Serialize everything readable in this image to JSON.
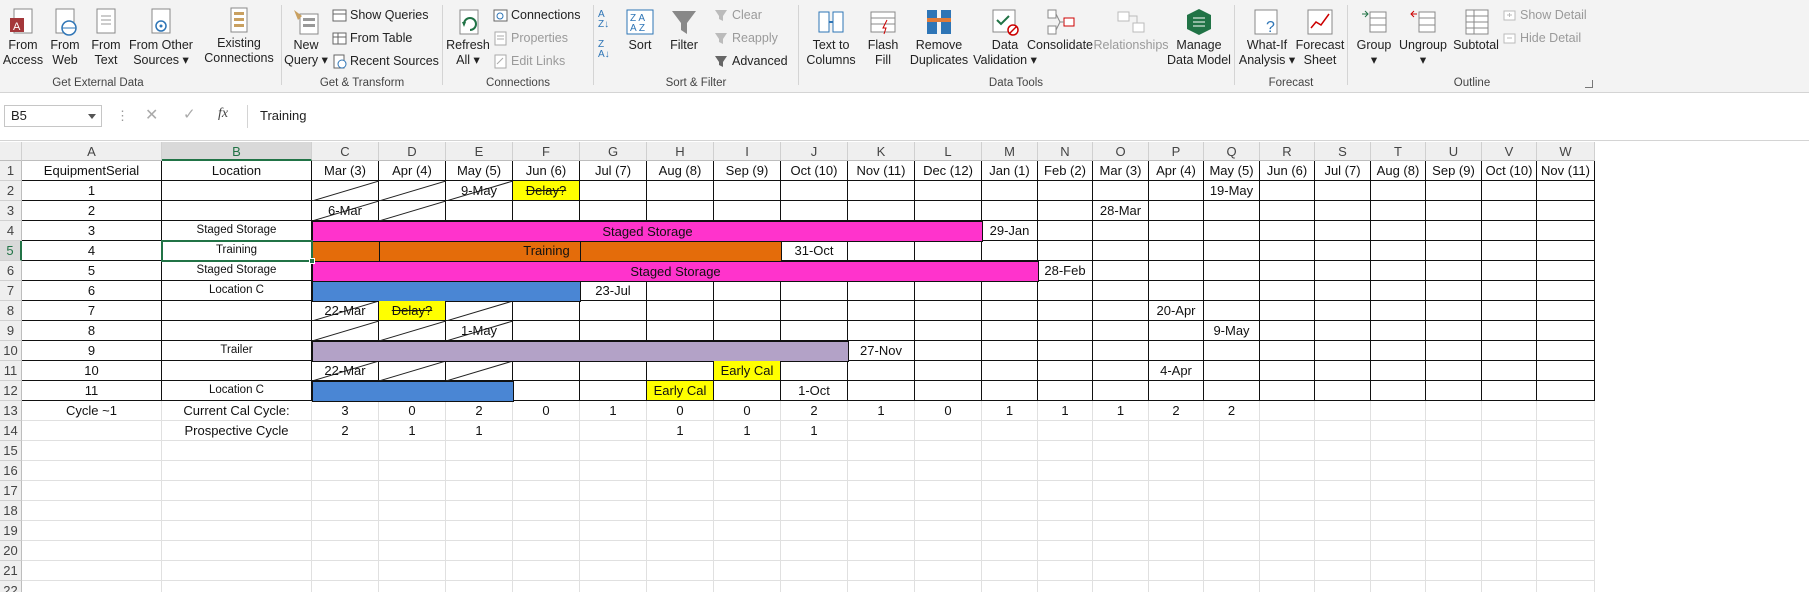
{
  "ribbon": {
    "get_external_data": {
      "label": "Get External Data",
      "from_access": "From\nAccess",
      "from_web": "From\nWeb",
      "from_text": "From\nText",
      "from_other": "From Other\nSources ▾",
      "existing": "Existing\nConnections"
    },
    "get_transform": {
      "label": "Get & Transform",
      "new_query": "New\nQuery ▾",
      "show_queries": "Show Queries",
      "from_table": "From Table",
      "recent_sources": "Recent Sources"
    },
    "connections": {
      "label": "Connections",
      "refresh_all": "Refresh\nAll ▾",
      "connections": "Connections",
      "properties": "Properties",
      "edit_links": "Edit Links"
    },
    "sort_filter": {
      "label": "Sort & Filter",
      "sort": "Sort",
      "filter": "Filter",
      "clear": "Clear",
      "reapply": "Reapply",
      "advanced": "Advanced"
    },
    "data_tools": {
      "label": "Data Tools",
      "text_to_columns": "Text to\nColumns",
      "flash_fill": "Flash\nFill",
      "remove_duplicates": "Remove\nDuplicates",
      "data_validation": "Data\nValidation ▾",
      "consolidate": "Consolidate",
      "relationships": "Relationships",
      "manage_data_model": "Manage\nData Model"
    },
    "forecast": {
      "label": "Forecast",
      "what_if": "What-If\nAnalysis ▾",
      "forecast_sheet": "Forecast\nSheet"
    },
    "outline": {
      "label": "Outline",
      "group": "Group\n▾",
      "ungroup": "Ungroup\n▾",
      "subtotal": "Subtotal",
      "show_detail": "Show Detail",
      "hide_detail": "Hide Detail"
    }
  },
  "formula_bar": {
    "name_box": "B5",
    "value": "Training"
  },
  "columns": [
    "A",
    "B",
    "C",
    "D",
    "E",
    "F",
    "G",
    "H",
    "I",
    "J",
    "K",
    "L",
    "M",
    "N",
    "O",
    "P",
    "Q",
    "R",
    "S",
    "T",
    "U",
    "V",
    "W"
  ],
  "row_numbers": [
    "1",
    "2",
    "3",
    "4",
    "5",
    "6",
    "7",
    "8",
    "9",
    "10",
    "11",
    "12",
    "13",
    "14",
    "15",
    "16",
    "17",
    "18",
    "19",
    "20",
    "21",
    "22"
  ],
  "headers": {
    "A": "EquipmentSerial",
    "B": "Location",
    "C": "Mar (3)",
    "D": "Apr (4)",
    "E": "May (5)",
    "F": "Jun (6)",
    "G": "Jul (7)",
    "H": "Aug (8)",
    "I": "Sep (9)",
    "J": "Oct (10)",
    "K": "Nov (11)",
    "L": "Dec (12)",
    "M": "Jan (1)",
    "N": "Feb (2)",
    "O": "Mar (3)",
    "P": "Apr (4)",
    "Q": "May (5)",
    "R": "Jun (6)",
    "S": "Jul (7)",
    "T": "Aug (8)",
    "U": "Sep (9)",
    "V": "Oct (10)",
    "W": "Nov (11)"
  },
  "serials": [
    "1",
    "2",
    "3",
    "4",
    "5",
    "6",
    "7",
    "8",
    "9",
    "10",
    "11"
  ],
  "locations": {
    "r4": "Staged Storage",
    "r5": "Training",
    "r6": "Staged Storage",
    "r7": "Location C",
    "r10": "Trailer",
    "r12": "Location C"
  },
  "cells": {
    "E2": "9-May",
    "F2": "Delay?",
    "Q2": "19-May",
    "C3": "6-Mar",
    "O3": "28-Mar",
    "M4": "29-Jan",
    "J5": "31-Oct",
    "N6": "28-Feb",
    "G7": "23-Jul",
    "C8": "22-Mar",
    "D8": "Delay?",
    "P8": "20-Apr",
    "E9": "1-May",
    "Q9": "9-May",
    "K10": "27-Nov",
    "C11": "22-Mar",
    "I11": "Early Cal",
    "P11": "4-Apr",
    "H12": "Early Cal",
    "J12": "1-Oct"
  },
  "bars": {
    "r4": "Staged Storage",
    "r5": "Training",
    "r6": "Staged Storage"
  },
  "summary": {
    "a13": "Cycle ~1",
    "b13": "Current Cal Cycle:",
    "b14": "Prospective Cycle",
    "row13": [
      "3",
      "0",
      "2",
      "0",
      "1",
      "0",
      "0",
      "2",
      "1",
      "0",
      "1",
      "1",
      "1",
      "2",
      "2"
    ],
    "row14": [
      "2",
      "1",
      "1",
      "",
      "",
      "1",
      "1",
      "1"
    ]
  },
  "colors": {
    "pink": "#ff33cc",
    "orange": "#e46c0a",
    "blue": "#4a86d4",
    "purple": "#b3a2c7",
    "yellow": "#ffff00",
    "excel_green": "#217346"
  }
}
